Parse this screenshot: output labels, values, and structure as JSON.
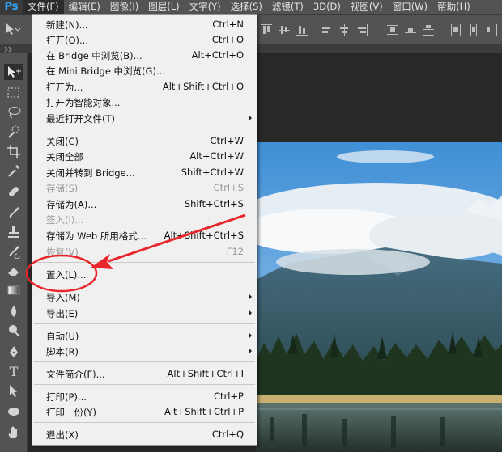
{
  "app": {
    "logo": "Ps"
  },
  "menubar": {
    "items": [
      "文件(F)",
      "编辑(E)",
      "图像(I)",
      "图层(L)",
      "文字(Y)",
      "选择(S)",
      "滤镜(T)",
      "3D(D)",
      "视图(V)",
      "窗口(W)",
      "帮助(H)"
    ]
  },
  "file_menu": {
    "new": {
      "label": "新建(N)...",
      "shortcut": "Ctrl+N"
    },
    "open": {
      "label": "打开(O)...",
      "shortcut": "Ctrl+O"
    },
    "browse_bridge": {
      "label": "在 Bridge 中浏览(B)...",
      "shortcut": "Alt+Ctrl+O"
    },
    "browse_mini_bridge": {
      "label": "在 Mini Bridge 中浏览(G)...",
      "shortcut": ""
    },
    "open_as": {
      "label": "打开为...",
      "shortcut": "Alt+Shift+Ctrl+O"
    },
    "open_smart": {
      "label": "打开为智能对象...",
      "shortcut": ""
    },
    "recent": {
      "label": "最近打开文件(T)",
      "shortcut": ""
    },
    "close": {
      "label": "关闭(C)",
      "shortcut": "Ctrl+W"
    },
    "close_all": {
      "label": "关闭全部",
      "shortcut": "Alt+Ctrl+W"
    },
    "close_goto_bridge": {
      "label": "关闭并转到 Bridge...",
      "shortcut": "Shift+Ctrl+W"
    },
    "save": {
      "label": "存储(S)",
      "shortcut": "Ctrl+S"
    },
    "save_as": {
      "label": "存储为(A)...",
      "shortcut": "Shift+Ctrl+S"
    },
    "check_in": {
      "label": "签入(I)...",
      "shortcut": ""
    },
    "save_web": {
      "label": "存储为 Web 所用格式...",
      "shortcut": "Alt+Shift+Ctrl+S"
    },
    "revert": {
      "label": "恢复(V)",
      "shortcut": "F12"
    },
    "place": {
      "label": "置入(L)...",
      "shortcut": ""
    },
    "import": {
      "label": "导入(M)",
      "shortcut": ""
    },
    "export": {
      "label": "导出(E)",
      "shortcut": ""
    },
    "automate": {
      "label": "自动(U)",
      "shortcut": ""
    },
    "scripts": {
      "label": "脚本(R)",
      "shortcut": ""
    },
    "file_info": {
      "label": "文件简介(F)...",
      "shortcut": "Alt+Shift+Ctrl+I"
    },
    "print": {
      "label": "打印(P)...",
      "shortcut": "Ctrl+P"
    },
    "print_one": {
      "label": "打印一份(Y)",
      "shortcut": "Alt+Shift+Ctrl+P"
    },
    "exit": {
      "label": "退出(X)",
      "shortcut": "Ctrl+Q"
    }
  },
  "colors": {
    "annotation": "#e8262c",
    "menu_bg": "#f0f0f0",
    "workspace_bg": "#535353",
    "canvas_bg": "#282828"
  }
}
